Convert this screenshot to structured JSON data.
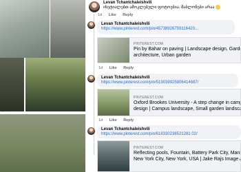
{
  "collage": {
    "caption": "— … … … …"
  },
  "top_comment": {
    "author": "Levan Tchantchaleishvili",
    "text": "იხეტიალებთ ამოკლებული ფოტოებია. შაბლონები არაა",
    "time": "1d",
    "like": "Like",
    "reply": "Reply"
  },
  "replies": [
    {
      "author": "Levan Tchantchaleishvili",
      "url": "https://www.pinterest.com/pin/45738926759116420...",
      "card": {
        "domain": "PINTEREST.COM",
        "title_lines": [
          "Pin by Bahar on paving | Landscape design, Garden",
          "architecture, Urban garden"
        ]
      },
      "time": "1d",
      "like": "Like",
      "reply": "Reply"
    },
    {
      "author": "Levan Tchantchaleishvili",
      "url": "https://www.pinterest.com/pin/519039925806414687/",
      "card": {
        "domain": "PINTEREST.COM",
        "title_lines": [
          "Oxford Brookes University - A step change in camp",
          "design | Campus landscape, Small garden landscap"
        ]
      },
      "time": "1d",
      "like": "Like",
      "reply": "Reply"
    },
    {
      "author": "Levan Tchantchaleishvili",
      "url": "https://www.pinterest.com/pin/618330238521281 02/",
      "card": {
        "domain": "PINTEREST.COM",
        "title_lines": [
          "Reflecting pools, Fountain, Battery Park City, Manh",
          "New York City, New York, USA | Jake Rajs Image A..."
        ]
      },
      "time": "",
      "like": "",
      "reply": ""
    }
  ]
}
